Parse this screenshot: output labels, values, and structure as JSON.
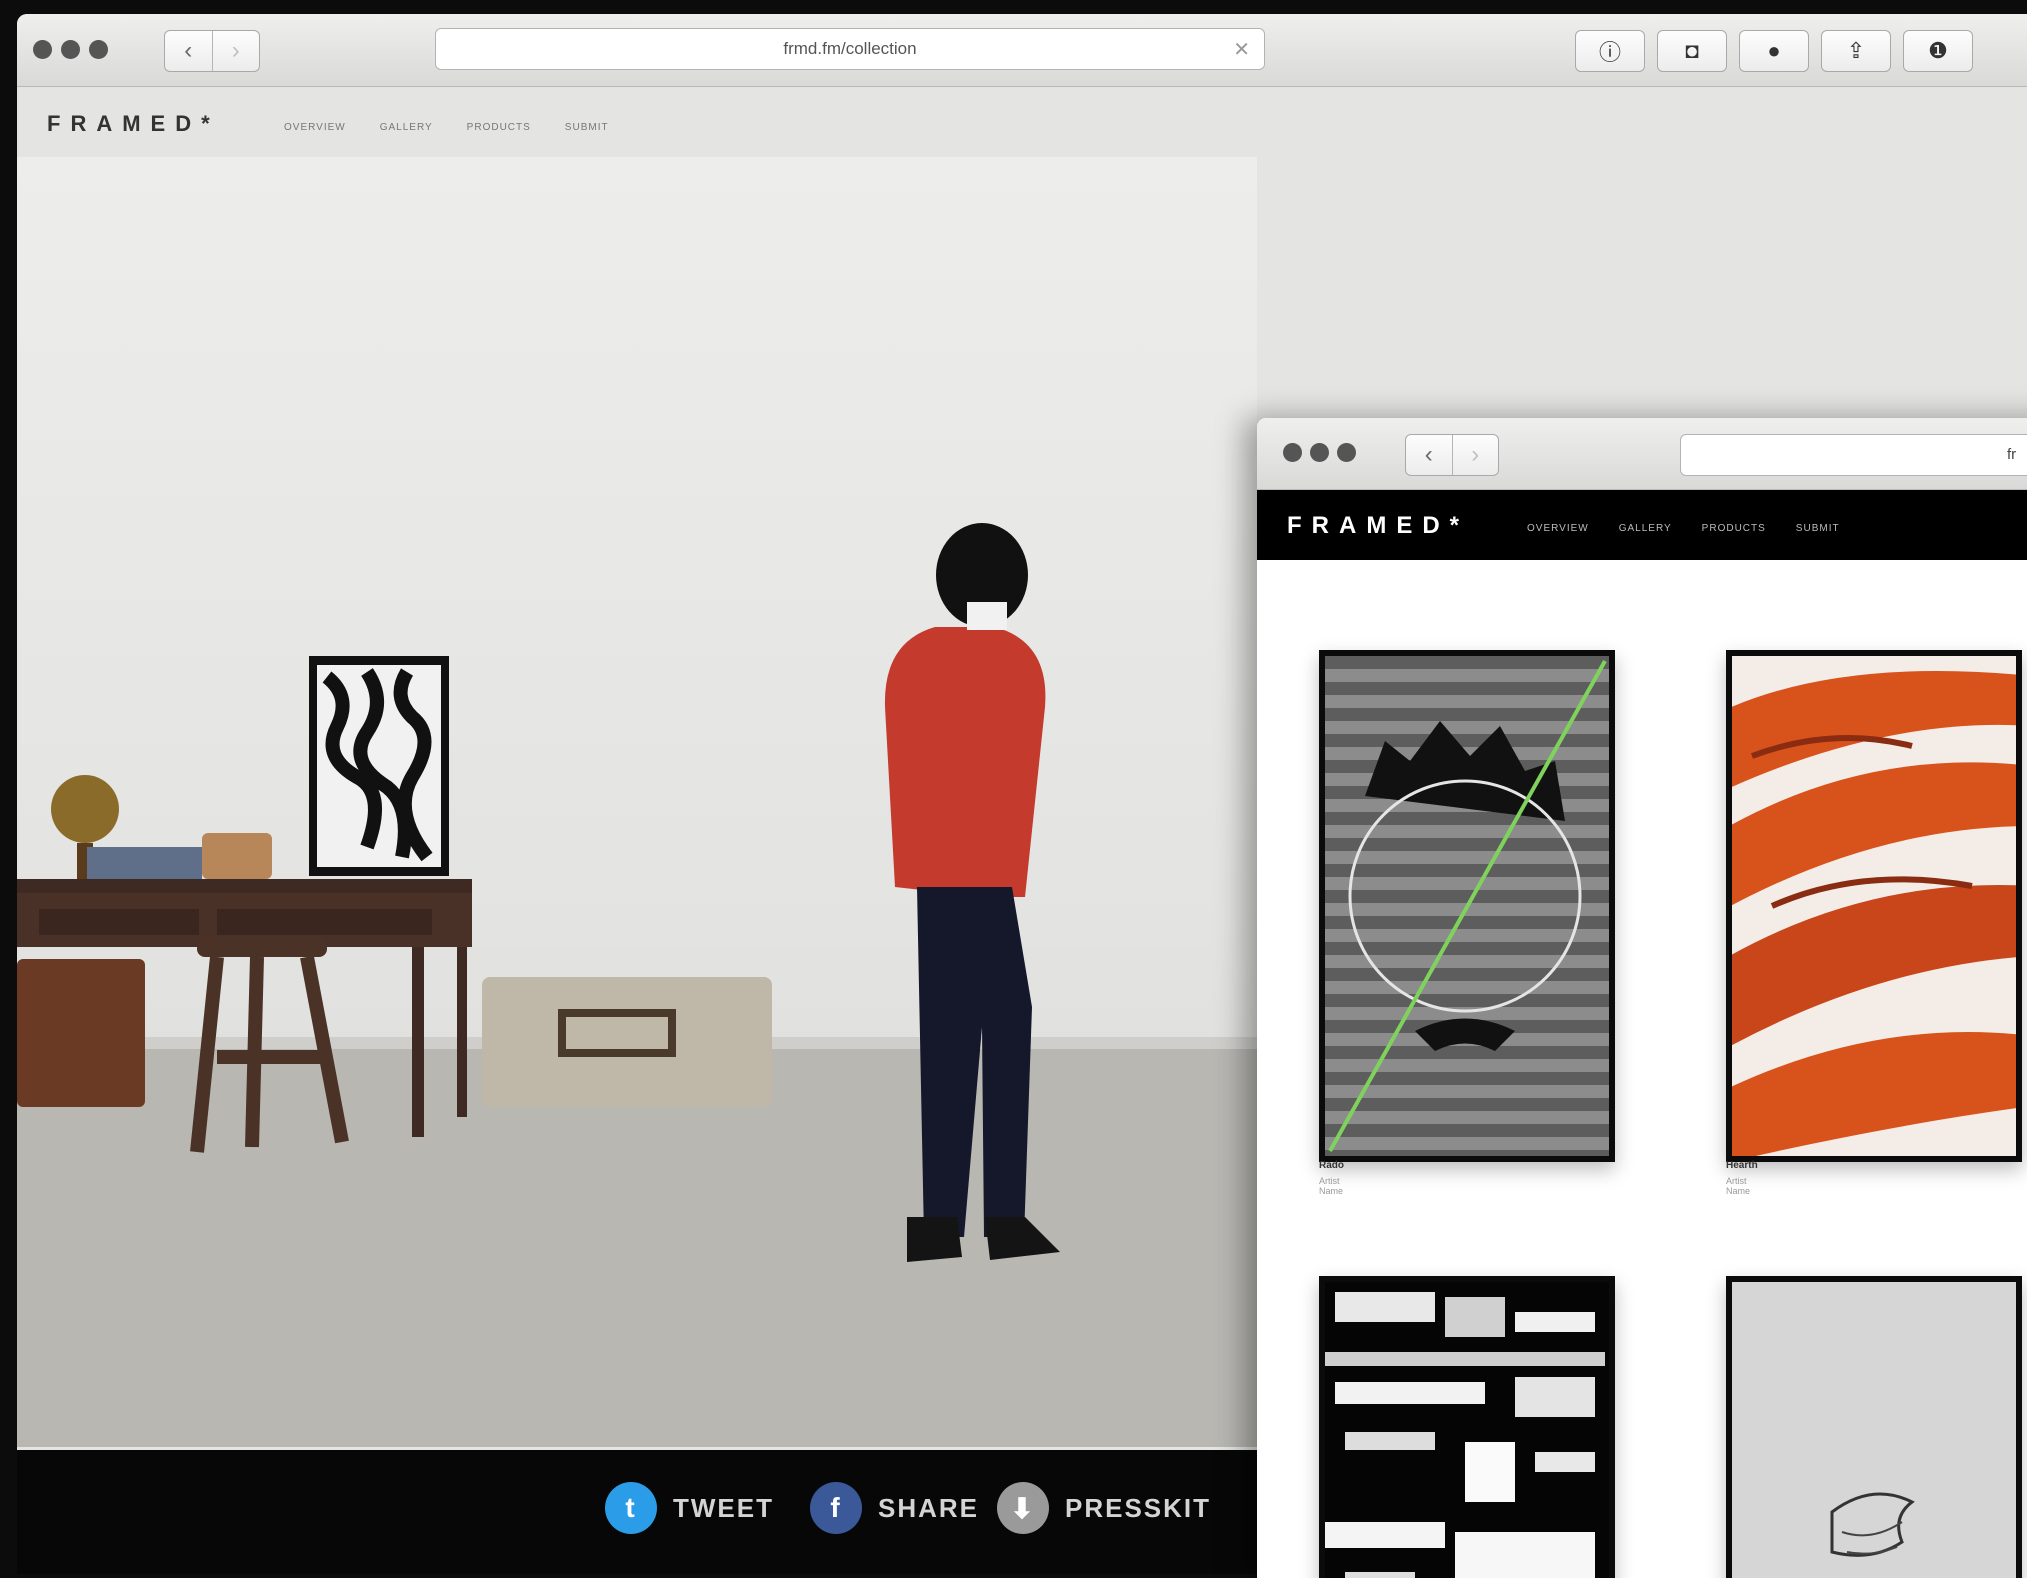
{
  "back_window": {
    "url": "frmd.fm/collection",
    "clear_glyph": "✕",
    "nav": {
      "back": "‹",
      "forward": "›"
    },
    "toolbar_icons": [
      {
        "name": "info-icon",
        "glyph": "ⓘ"
      },
      {
        "name": "pocket-icon",
        "glyph": "◘"
      },
      {
        "name": "globe-icon",
        "glyph": "●"
      },
      {
        "name": "share-icon",
        "glyph": "⇪"
      },
      {
        "name": "download-icon",
        "glyph": "❶"
      }
    ],
    "logo": "FRAMED*",
    "menu": [
      "OVERVIEW",
      "GALLERY",
      "PRODUCTS",
      "SUBMIT"
    ],
    "share_bar": [
      {
        "icon": "twitter-icon",
        "glyph": "t",
        "label": "TWEET",
        "color": "#2b9ce8"
      },
      {
        "icon": "facebook-icon",
        "glyph": "f",
        "label": "SHARE",
        "color": "#3b5998"
      },
      {
        "icon": "presskit-download-icon",
        "glyph": "⬇",
        "label": "PRESSKIT",
        "color": "#9a9a9a"
      }
    ]
  },
  "front_window": {
    "url": "fr",
    "nav": {
      "back": "‹",
      "forward": "›"
    },
    "logo": "FRAMED*",
    "menu": [
      "OVERVIEW",
      "GALLERY",
      "PRODUCTS",
      "SUBMIT"
    ],
    "gallery": [
      {
        "title": "Rado",
        "artist": "Artist Name"
      },
      {
        "title": "Hearth",
        "artist": "Artist Name"
      }
    ]
  },
  "colors": {
    "accent_red": "#c43a2d",
    "orange_art": "#d8521c",
    "green_line": "#7fd35c"
  }
}
